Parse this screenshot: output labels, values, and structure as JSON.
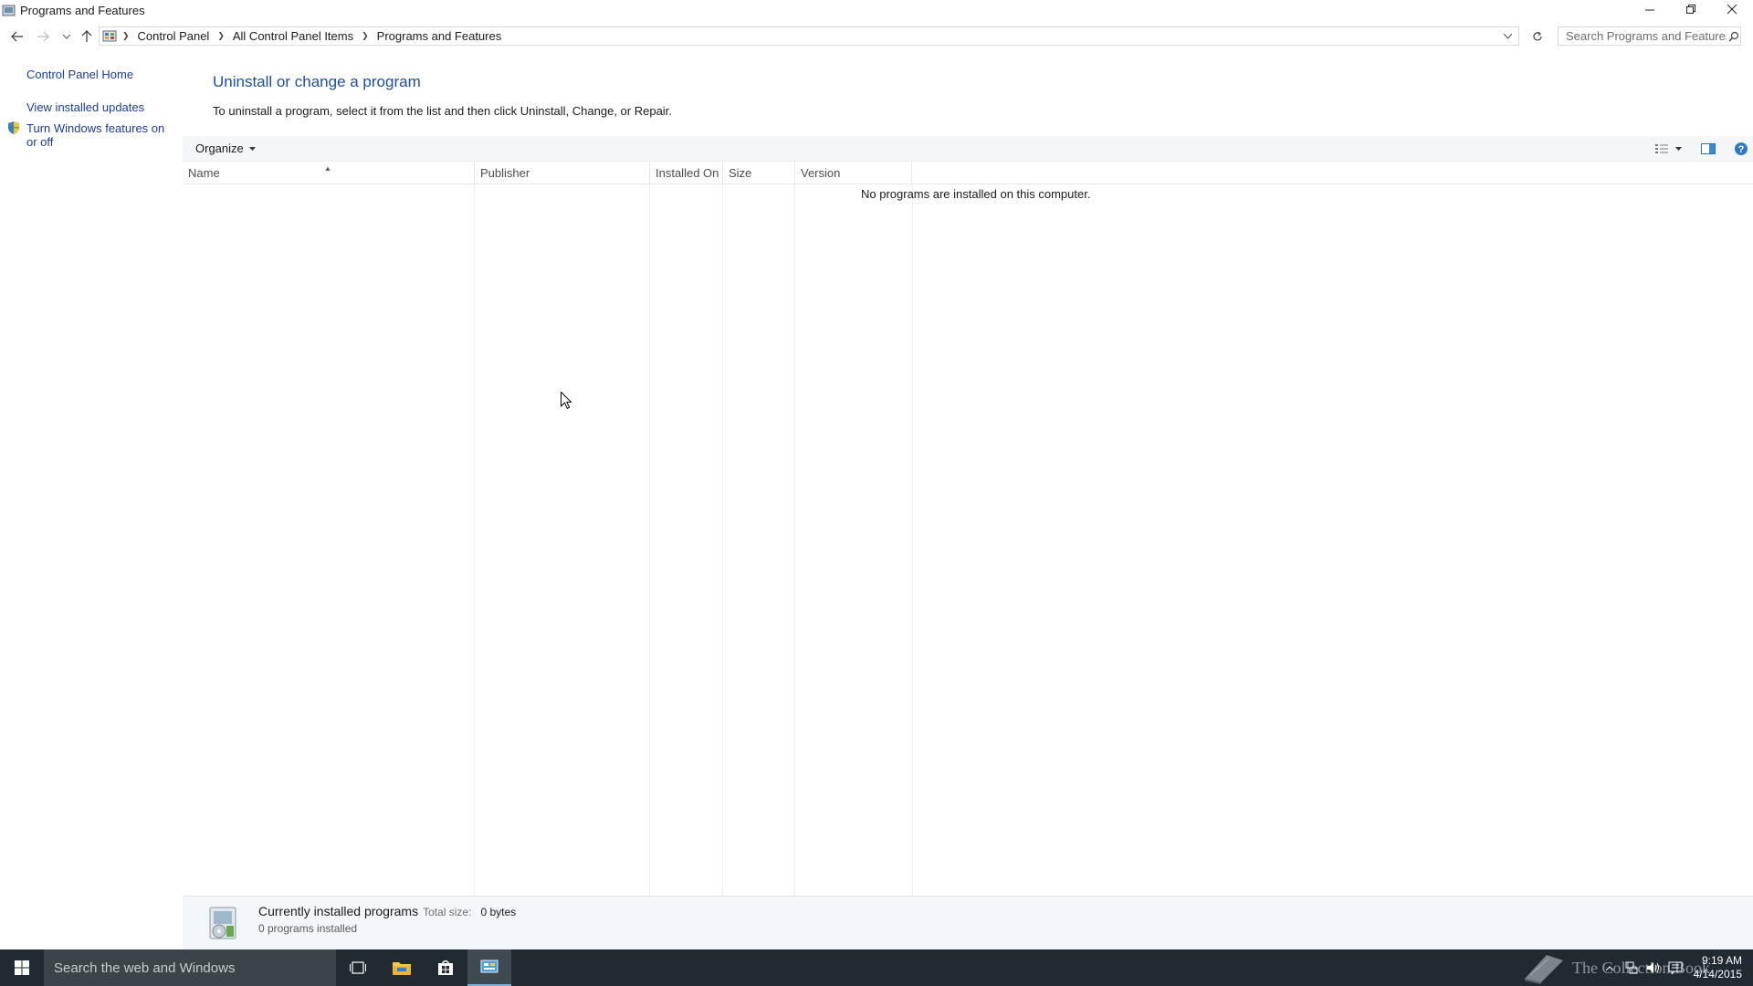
{
  "window": {
    "title": "Programs and Features",
    "controls": {
      "minimize": "minimize-icon",
      "restore": "restore-icon",
      "close": "close-icon"
    }
  },
  "address_bar": {
    "crumbs": [
      "Control Panel",
      "All Control Panel Items",
      "Programs and Features"
    ],
    "search_placeholder": "Search Programs and Features"
  },
  "left_pane": {
    "links": [
      "Control Panel Home",
      "View installed updates",
      "Turn Windows features on or off"
    ]
  },
  "main": {
    "heading": "Uninstall or change a program",
    "instructions": "To uninstall a program, select it from the list and then click Uninstall, Change, or Repair.",
    "organize_label": "Organize",
    "columns": [
      "Name",
      "Publisher",
      "Installed On",
      "Size",
      "Version"
    ],
    "sort_column": "Name",
    "empty_message": "No programs are installed on this computer."
  },
  "details": {
    "title": "Currently installed programs",
    "total_size_label": "Total size:",
    "total_size_value": "0 bytes",
    "count": "0 programs installed"
  },
  "taskbar": {
    "search_placeholder": "Search the web and Windows",
    "watermark": "The Collection Book",
    "time": "9:19 AM",
    "date": "4/14/2015"
  },
  "colors": {
    "link": "#1a3c9e",
    "heading": "#1e4e9c",
    "taskbar": "#202a30"
  }
}
